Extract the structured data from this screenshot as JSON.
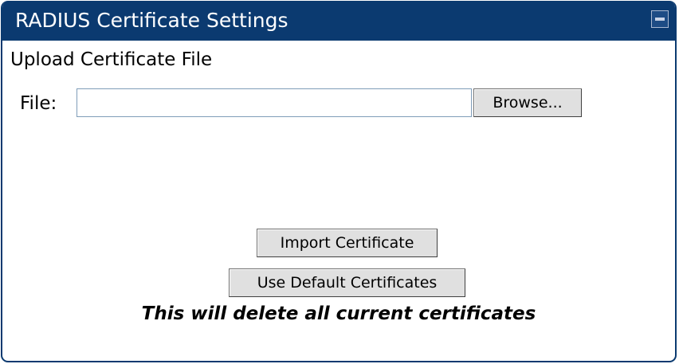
{
  "panel": {
    "title": "RADIUS Certificate Settings",
    "collapse_icon": "minus-square-icon"
  },
  "upload": {
    "section_label": "Upload Certificate File",
    "file_label": "File:",
    "file_value": "",
    "browse_label": "Browse..."
  },
  "actions": {
    "import_label": "Import Certificate",
    "default_label": "Use Default Certificates",
    "warning_text": "This will delete all current certificates"
  },
  "colors": {
    "titlebar": "#0b3a70",
    "title_text": "#ffffff",
    "button_bg": "#e0e0e0"
  }
}
